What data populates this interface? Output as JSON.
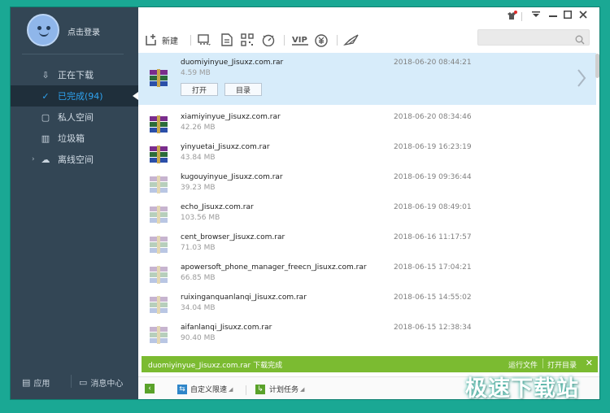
{
  "user": {
    "login_label": "点击登录"
  },
  "sidebar": {
    "items": [
      {
        "label": "正在下载",
        "icon": "download-icon"
      },
      {
        "label": "已完成(94)",
        "icon": "check-circle-icon"
      },
      {
        "label": "私人空间",
        "icon": "lock-icon"
      },
      {
        "label": "垃圾箱",
        "icon": "trash-icon"
      },
      {
        "label": "离线空间",
        "icon": "cloud-icon"
      }
    ],
    "bottom": {
      "apps_label": "应用",
      "messages_label": "消息中心"
    }
  },
  "toolbar": {
    "new_label": "新建"
  },
  "search": {
    "placeholder": ""
  },
  "files": [
    {
      "name": "duomiyinyue_Jisuxz.com.rar",
      "size": "4.59 MB",
      "date": "2018-06-20 08:44:21",
      "selected": true,
      "open_label": "打开",
      "folder_label": "目录"
    },
    {
      "name": "xiamiyinyue_Jisuxz.com.rar",
      "size": "42.26 MB",
      "date": "2018-06-20 08:34:46"
    },
    {
      "name": "yinyuetai_Jisuxz.com.rar",
      "size": "43.84 MB",
      "date": "2018-06-19 16:23:19"
    },
    {
      "name": "kugouyinyue_Jisuxz.com.rar",
      "size": "39.23 MB",
      "date": "2018-06-19 09:36:44"
    },
    {
      "name": "echo_Jisuxz.com.rar",
      "size": "103.56 MB",
      "date": "2018-06-19 08:49:01"
    },
    {
      "name": "cent_browser_Jisuxz.com.rar",
      "size": "71.03 MB",
      "date": "2018-06-16 11:17:57"
    },
    {
      "name": "apowersoft_phone_manager_freecn_Jisuxz.com.rar",
      "size": "66.85 MB",
      "date": "2018-06-15 17:04:21"
    },
    {
      "name": "ruixinganquanlanqi_Jisuxz.com.rar",
      "size": "34.04 MB",
      "date": "2018-06-15 14:55:02"
    },
    {
      "name": "aifanlanqi_Jisuxz.com.rar",
      "size": "90.40 MB",
      "date": "2018-06-15 12:38:34"
    }
  ],
  "notification": {
    "message": "duomiyinyue_Jisuxz.com.rar 下载完成",
    "run_label": "运行文件",
    "open_dir_label": "打开目录"
  },
  "statusbar": {
    "speed_label": "自定义限速",
    "plan_label": "计划任务"
  },
  "watermark": "极速下载站",
  "colors": {
    "accent": "#2fa3f0",
    "selected_row": "#d7ecfa",
    "notify": "#7bbb31",
    "sidebar": "#334655",
    "frame": "#1aa894"
  }
}
